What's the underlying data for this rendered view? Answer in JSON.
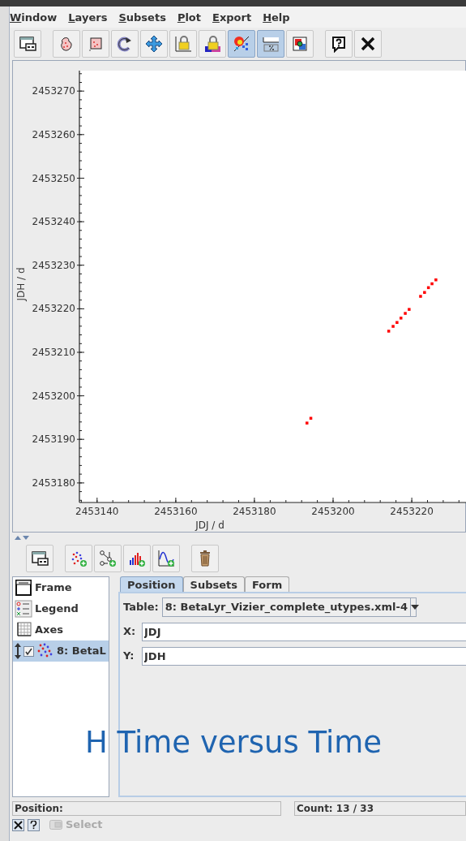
{
  "menu": [
    "Window",
    "Layers",
    "Subsets",
    "Plot",
    "Export",
    "Help"
  ],
  "toolbar": [
    {
      "kind": "window",
      "selected": false
    },
    {
      "kind": "zoom-blob",
      "selected": false
    },
    {
      "kind": "zoom-rect",
      "selected": false
    },
    {
      "kind": "reset",
      "selected": false
    },
    {
      "kind": "pan",
      "selected": false
    },
    {
      "kind": "lock-axes",
      "selected": false
    },
    {
      "kind": "lock-aux",
      "selected": false
    },
    {
      "kind": "density",
      "selected": true
    },
    {
      "kind": "percent",
      "selected": true
    },
    {
      "kind": "export",
      "selected": false
    },
    {
      "kind": "help",
      "selected": false
    },
    {
      "kind": "close",
      "selected": false
    }
  ],
  "plot": {
    "chart_data": {
      "type": "scatter",
      "xlabel": "JDJ / d",
      "ylabel": "JDH / d",
      "xlim": [
        2453135.5,
        2453234
      ],
      "ylim": [
        2453175.5,
        2453274.7
      ],
      "xticks": [
        2453140,
        2453160,
        2453180,
        2453200,
        2453220
      ],
      "yticks": [
        2453180,
        2453190,
        2453200,
        2453210,
        2453220,
        2453230,
        2453240,
        2453250,
        2453260,
        2453270
      ],
      "series": [
        {
          "color": "#ff0000",
          "x": [
            2453193.4,
            2453194.4,
            2453214.2,
            2453215.3,
            2453216.3,
            2453217.3,
            2453218.4,
            2453219.4,
            2453222.3,
            2453223.3,
            2453224.3,
            2453225.2,
            2453226.2
          ],
          "values": [
            2453193.7,
            2453194.8,
            2453214.8,
            2453215.9,
            2453216.8,
            2453217.8,
            2453218.9,
            2453219.8,
            2453222.8,
            2453223.7,
            2453224.8,
            2453225.7,
            2453226.6
          ]
        }
      ]
    }
  },
  "layer_toolbar": [
    {
      "kind": "window"
    },
    {
      "kind": "add-scatter"
    },
    {
      "kind": "add-link"
    },
    {
      "kind": "add-histogram"
    },
    {
      "kind": "add-function"
    },
    {
      "kind": "delete"
    }
  ],
  "layers": [
    {
      "kind": "frame",
      "label": "Frame",
      "selected": false
    },
    {
      "kind": "legend",
      "label": "Legend",
      "selected": false
    },
    {
      "kind": "axes",
      "label": "Axes",
      "selected": false
    },
    {
      "kind": "layer",
      "label": "8: BetaL",
      "selected": true,
      "checked": true
    }
  ],
  "tabs": [
    {
      "label": "Position",
      "selected": true
    },
    {
      "label": "Subsets",
      "selected": false
    },
    {
      "label": "Form",
      "selected": false
    }
  ],
  "position": {
    "table_label": "Table:",
    "table": "8: BetaLyr_Vizier_complete_utypes.xml-4",
    "fields": [
      {
        "label": "X:",
        "value": "JDJ"
      },
      {
        "label": "Y:",
        "value": "JDH"
      }
    ]
  },
  "status": {
    "position": "Position:",
    "count": "Count: 13 / 33"
  },
  "bottom": {
    "select": "Select",
    "select_disabled": true
  },
  "caption": "H Time versus Time"
}
